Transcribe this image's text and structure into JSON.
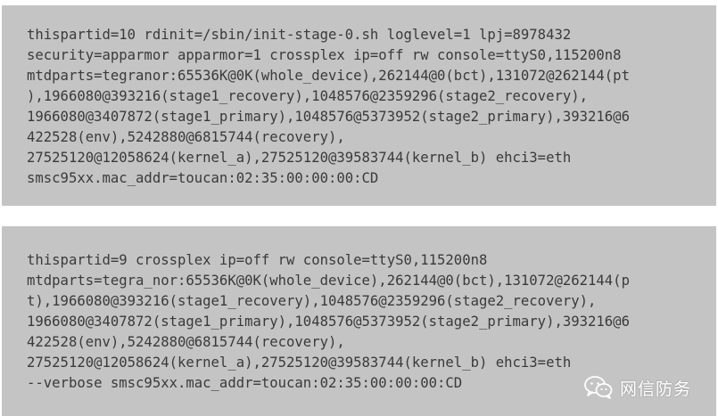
{
  "blocks": [
    {
      "lines": [
        "thispartid=10 rdinit=/sbin/init-stage-0.sh loglevel=1 lpj=8978432",
        "security=apparmor apparmor=1 crossplex ip=off rw console=ttyS0,115200n8",
        "mtdparts=tegranor:65536K@0K(whole_device),262144@0(bct),131072@262144(pt",
        "),1966080@393216(stage1_recovery),1048576@2359296(stage2_recovery),",
        "1966080@3407872(stage1_primary),1048576@5373952(stage2_primary),393216@6",
        "422528(env),5242880@6815744(recovery),",
        "27525120@12058624(kernel_a),27525120@39583744(kernel_b) ehci3=eth",
        "smsc95xx.mac_addr=toucan:02:35:00:00:00:CD"
      ]
    },
    {
      "lines": [
        "thispartid=9 crossplex ip=off rw console=ttyS0,115200n8",
        "mtdparts=tegra_nor:65536K@0K(whole_device),262144@0(bct),131072@262144(p",
        "t),1966080@393216(stage1_recovery),1048576@2359296(stage2_recovery),",
        "1966080@3407872(stage1_primary),1048576@5373952(stage2_primary),393216@6",
        "422528(env),5242880@6815744(recovery),",
        "27525120@12058624(kernel_a),27525120@39583744(kernel_b) ehci3=eth",
        "--verbose smsc95xx.mac_addr=toucan:02:35:00:00:00:CD"
      ]
    }
  ],
  "watermark": {
    "text": "网信防务",
    "icon": "wechat-icon"
  },
  "colors": {
    "block_background": "#c4c4c4",
    "text": "#3a3a3a",
    "page_background": "#ffffff"
  }
}
